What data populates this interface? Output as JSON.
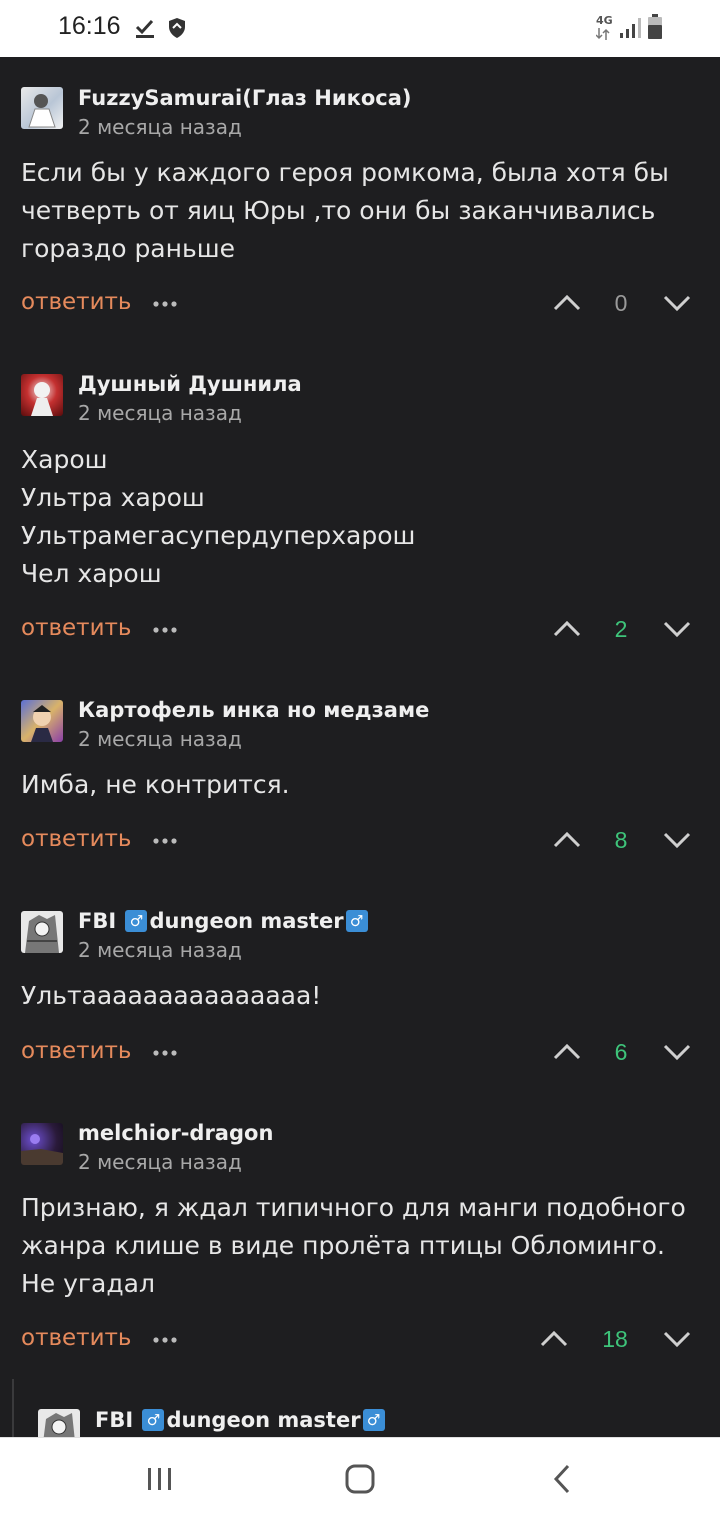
{
  "status_bar": {
    "time": "16:16",
    "network": "4G"
  },
  "comments": [
    {
      "author": "FuzzySamurai(Глаз Никоса)",
      "time": "2 месяца назад",
      "lines": [
        "Если бы у каждого героя ромкома, была хотя бы",
        "четверть от яиц Юры ,то они бы заканчивались",
        "гораздо раньше"
      ],
      "reply": "ответить",
      "votes": "0",
      "vote_color": "#9a9a9a"
    },
    {
      "author": "Душный Душнила",
      "time": "2 месяца назад",
      "lines": [
        "Харош",
        "Ультра харош",
        "Ультрамегасупердуперхарош",
        "Чел харош"
      ],
      "reply": "ответить",
      "votes": "2",
      "vote_color": "#3ec47a"
    },
    {
      "author": "Картофель инка но медзаме",
      "time": "2 месяца назад",
      "lines": [
        "Имба, не контрится."
      ],
      "reply": "ответить",
      "votes": "8",
      "vote_color": "#3ec47a"
    },
    {
      "author_parts": [
        "FBI ",
        "♂",
        "dungeon master",
        "♂"
      ],
      "time": "2 месяца назад",
      "lines": [
        "Ультааааааааааааааа!"
      ],
      "reply": "ответить",
      "votes": "6",
      "vote_color": "#3ec47a"
    },
    {
      "author": "melchior-dragon",
      "time": "2 месяца назад",
      "lines": [
        "Признаю, я ждал типичного для манги подобного",
        "жанра клише в виде пролёта птицы Обломинго.",
        "Не угадал"
      ],
      "reply": "ответить",
      "votes": "18",
      "vote_color": "#3ec47a"
    }
  ],
  "nested_reply": {
    "author_parts": [
      "FBI ",
      "♂",
      "dungeon master",
      "♂"
    ]
  },
  "icons": {
    "more": "more-dots-icon",
    "upvote": "chevron-up-icon",
    "downvote": "chevron-down-icon",
    "nav": [
      "recents-icon",
      "home-icon",
      "back-icon"
    ]
  },
  "colors": {
    "background": "#1e1e20",
    "reply_link": "#e58a5c",
    "positive_votes": "#3ec47a"
  }
}
